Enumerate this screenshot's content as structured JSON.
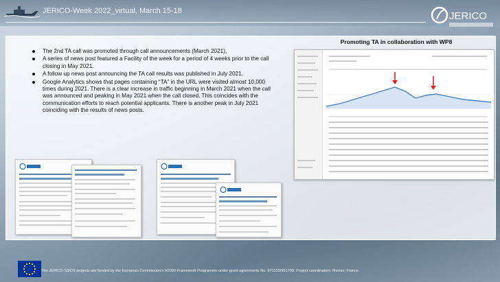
{
  "header": {
    "title": "JERICO-Week 2022_virtual, March 15-18",
    "logo_text": "JERICO"
  },
  "bullets": [
    "The 2nd TA call was promoted through call announcements (March 2021),",
    "A series of news post featured a Facility of the week for a period of 4 weeks prior to the call closing in May 2021.",
    "A follow up news post announcing the TA call results was published in July 2021.",
    "Google Analytics shows that pages containing “TA” in the URL were visited almost 10,000 times during 2021. There is a clear increase in traffic beginning in March 2021 when the call was announced and peaking in May 2021 when the call closed. This coincides with the communication efforts to reach potential applicants. There is another peak in July 2021 coinciding with the results of news posts."
  ],
  "right_panel": {
    "title": "Promoting TA in collaboration with WP8"
  },
  "footer": {
    "text": "The JERICO-S3/DS projects are funded by the European Commission’s H2020 Framework Programme under grant agreements No. 871153/951799. Project coordinators: Ifremer, France."
  },
  "colors": {
    "accent_red": "#e02020",
    "chart_blue": "#4a7fc1"
  }
}
